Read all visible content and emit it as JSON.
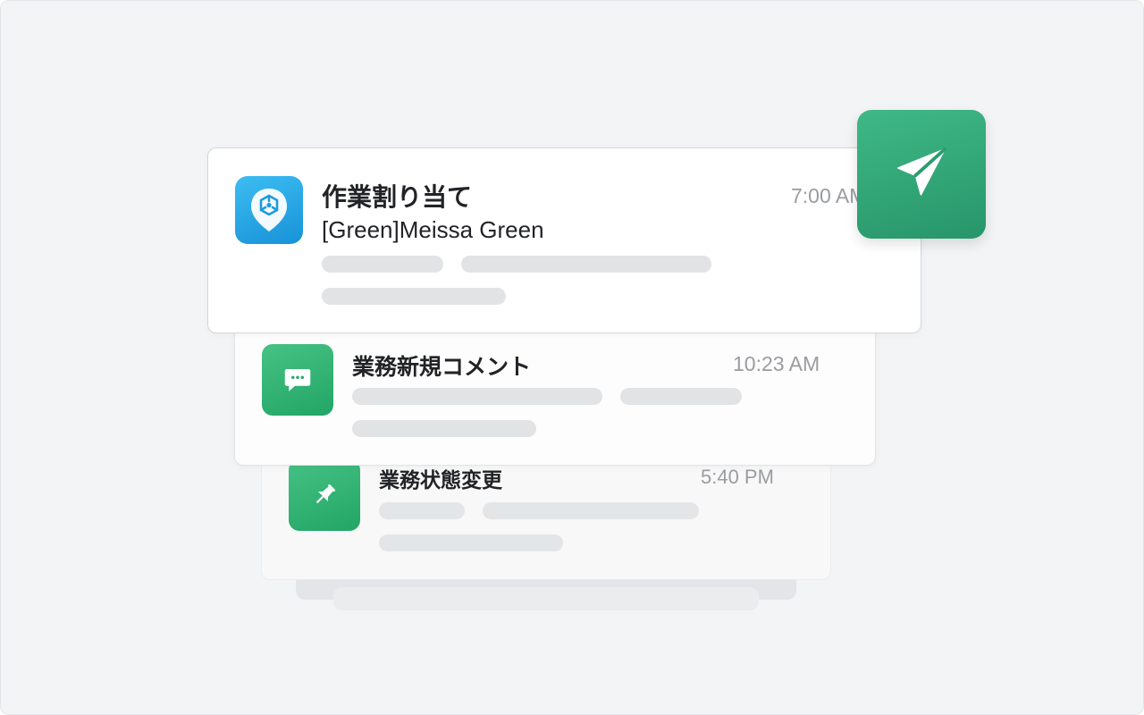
{
  "notifications": [
    {
      "title": "作業割り当て",
      "subtitle": "[Green]Meissa Green",
      "time": "7:00 AM",
      "icon": "app-logo-icon",
      "icon_color": "#1f9fe3"
    },
    {
      "title": "業務新規コメント",
      "time": "10:23 AM",
      "icon": "comment-icon",
      "icon_color": "#2fb06f"
    },
    {
      "title": "業務状態変更",
      "time": "5:40 PM",
      "icon": "pin-icon",
      "icon_color": "#2fb06f"
    }
  ],
  "send_badge": {
    "icon": "send-icon",
    "color": "#2fa877"
  },
  "colors": {
    "background": "#f3f4f6",
    "placeholder": "#e2e3e5",
    "text": "#222326",
    "muted": "#9a9ca0"
  }
}
